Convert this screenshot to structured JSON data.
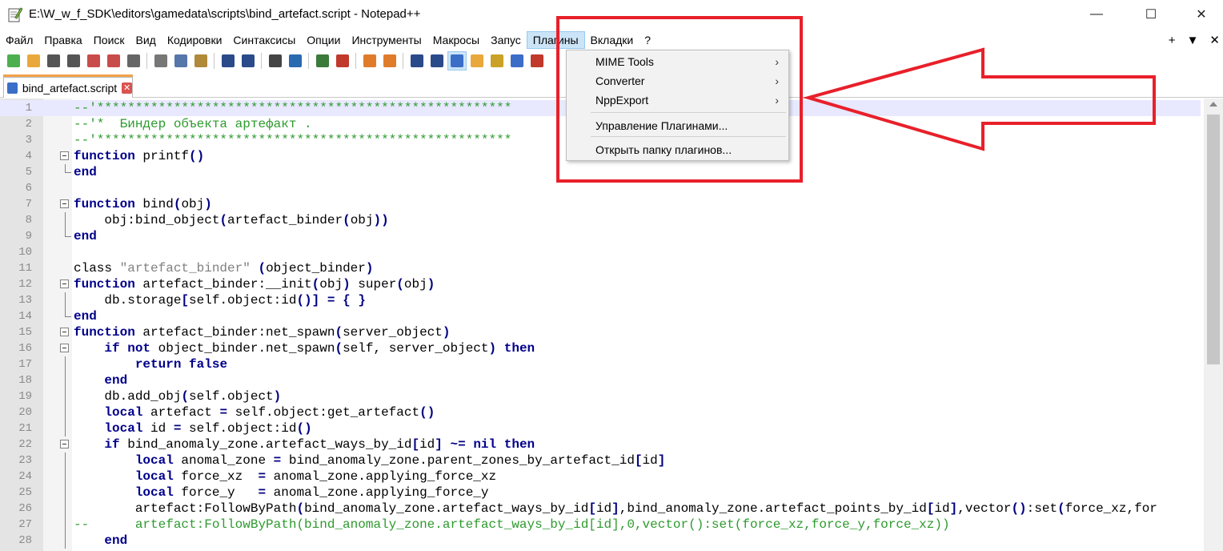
{
  "window": {
    "title": "E:\\W_w_f_SDK\\editors\\gamedata\\scripts\\bind_artefact.script - Notepad++",
    "minimize": "—",
    "maximize": "☐",
    "close": "✕"
  },
  "menubar": {
    "items": [
      "Файл",
      "Правка",
      "Поиск",
      "Вид",
      "Кодировки",
      "Синтаксисы",
      "Опции",
      "Инструменты",
      "Макросы",
      "Запус",
      "Плагины",
      "Вкладки",
      "?"
    ],
    "active_index": 10,
    "right": [
      "+",
      "▼",
      "✕"
    ]
  },
  "toolbar": {
    "icons": [
      "new-file-icon",
      "open-file-icon",
      "save-icon",
      "save-all-icon",
      "close-icon",
      "close-all-icon",
      "print-icon",
      "cut-icon",
      "copy-icon",
      "paste-icon",
      "undo-icon",
      "redo-icon",
      "find-icon",
      "replace-icon",
      "zoom-in-icon",
      "zoom-out-icon",
      "sync-v-icon",
      "sync-h-icon",
      "word-wrap-icon",
      "show-all-chars-icon",
      "indent-guide-icon",
      "doc-map-icon",
      "function-list-icon",
      "folder-workspace-icon",
      "macro-icon"
    ]
  },
  "tab": {
    "label": "bind_artefact.script",
    "close": "✕"
  },
  "dropdown": {
    "items": [
      {
        "label": "MIME Tools",
        "submenu": true
      },
      {
        "label": "Converter",
        "submenu": true
      },
      {
        "label": "NppExport",
        "submenu": true
      },
      {
        "label": "Управление Плагинами...",
        "submenu": false
      },
      {
        "label": "Открыть папку плагинов...",
        "submenu": false
      }
    ],
    "chevron": "›"
  },
  "editor": {
    "current_line": 1,
    "lines": [
      {
        "n": "1",
        "html": "<span class='cm'>--'******************************************************</span>"
      },
      {
        "n": "2",
        "html": "<span class='cm'>--'*  Биндер объекта артефакт .</span>"
      },
      {
        "n": "3",
        "html": "<span class='cm'>--'******************************************************</span>"
      },
      {
        "n": "4",
        "html": "<span class='kw'>function</span> printf<span class='op'>()</span>"
      },
      {
        "n": "5",
        "html": "<span class='kw'>end</span>"
      },
      {
        "n": "6",
        "html": ""
      },
      {
        "n": "7",
        "html": "<span class='kw'>function</span> bind<span class='op'>(</span>obj<span class='op'>)</span>"
      },
      {
        "n": "8",
        "html": "    obj:bind_object<span class='op'>(</span>artefact_binder<span class='op'>(</span>obj<span class='op'>))</span>"
      },
      {
        "n": "9",
        "html": "<span class='kw'>end</span>"
      },
      {
        "n": "10",
        "html": ""
      },
      {
        "n": "11",
        "html": "class <span class='str'>\"artefact_binder\"</span> <span class='op'>(</span>object_binder<span class='op'>)</span>"
      },
      {
        "n": "12",
        "html": "<span class='kw'>function</span> artefact_binder:__init<span class='op'>(</span>obj<span class='op'>)</span> super<span class='op'>(</span>obj<span class='op'>)</span>"
      },
      {
        "n": "13",
        "html": "    db.storage<span class='op'>[</span>self.object:id<span class='op'>()]</span> <span class='op'>=</span> <span class='op'>{</span> <span class='op'>}</span>"
      },
      {
        "n": "14",
        "html": "<span class='kw'>end</span>"
      },
      {
        "n": "15",
        "html": "<span class='kw'>function</span> artefact_binder:net_spawn<span class='op'>(</span>server_object<span class='op'>)</span>"
      },
      {
        "n": "16",
        "html": "    <span class='kw'>if</span> <span class='kw'>not</span> object_binder.net_spawn<span class='op'>(</span>self, server_object<span class='op'>)</span> <span class='kw'>then</span>"
      },
      {
        "n": "17",
        "html": "        <span class='kw'>return</span> <span class='kw'>false</span>"
      },
      {
        "n": "18",
        "html": "    <span class='kw'>end</span>"
      },
      {
        "n": "19",
        "html": "    db.add_obj<span class='op'>(</span>self.object<span class='op'>)</span>"
      },
      {
        "n": "20",
        "html": "    <span class='kw'>local</span> artefact <span class='op'>=</span> self.object:get_artefact<span class='op'>()</span>"
      },
      {
        "n": "21",
        "html": "    <span class='kw'>local</span> id <span class='op'>=</span> self.object:id<span class='op'>()</span>"
      },
      {
        "n": "22",
        "html": "    <span class='kw'>if</span> bind_anomaly_zone.artefact_ways_by_id<span class='op'>[</span>id<span class='op'>]</span> <span class='op'>~=</span> <span class='kw'>nil</span> <span class='kw'>then</span>"
      },
      {
        "n": "23",
        "html": "        <span class='kw'>local</span> anomal_zone <span class='op'>=</span> bind_anomaly_zone.parent_zones_by_artefact_id<span class='op'>[</span>id<span class='op'>]</span>"
      },
      {
        "n": "24",
        "html": "        <span class='kw'>local</span> force_xz  <span class='op'>=</span> anomal_zone.applying_force_xz"
      },
      {
        "n": "25",
        "html": "        <span class='kw'>local</span> force_y   <span class='op'>=</span> anomal_zone.applying_force_y"
      },
      {
        "n": "26",
        "html": "        artefact:FollowByPath<span class='op'>(</span>bind_anomaly_zone.artefact_ways_by_id<span class='op'>[</span>id<span class='op'>]</span>,bind_anomaly_zone.artefact_points_by_id<span class='op'>[</span>id<span class='op'>]</span>,vector<span class='op'>()</span>:set<span class='op'>(</span>force_xz,for"
      },
      {
        "n": "27",
        "html": "<span class='cm'>--      artefact:FollowByPath(bind_anomaly_zone.artefact_ways_by_id[id],0,vector():set(force_xz,force_y,force_xz))</span>"
      },
      {
        "n": "28",
        "html": "    <span class='kw'>end</span>"
      }
    ],
    "folds": {
      "4": "open",
      "5": "end",
      "7": "open",
      "8": "line",
      "9": "end",
      "12": "open",
      "13": "line",
      "14": "end",
      "15": "open",
      "16": "open",
      "17": "line",
      "18": "line",
      "19": "line",
      "20": "line",
      "21": "line",
      "22": "open",
      "23": "line",
      "24": "line",
      "25": "line",
      "26": "line",
      "27": "line",
      "28": "line"
    }
  },
  "colors": {
    "annotation": "#e8202a",
    "keyword": "#00008b",
    "comment": "#2e9a2e",
    "menu_highlight": "#cce4f7"
  }
}
